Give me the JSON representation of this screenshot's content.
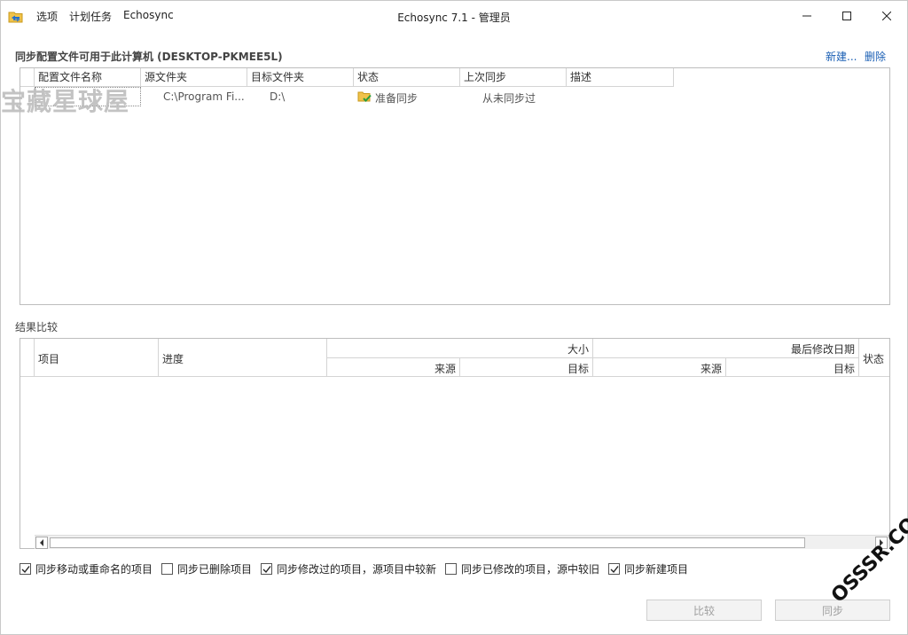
{
  "titlebar": {
    "app_icon": "folder-sync-icon",
    "menu": [
      "选项",
      "计划任务",
      "Echosync"
    ],
    "title": "Echosync 7.1 - 管理员",
    "controls": [
      "minimize-icon",
      "maximize-icon",
      "close-icon"
    ]
  },
  "profiles": {
    "heading": "同步配置文件可用于此计算机 (DESKTOP-PKMEE5L)",
    "new_link": "新建...",
    "delete_link": "删除",
    "columns": [
      "配置文件名称",
      "源文件夹",
      "目标文件夹",
      "状态",
      "上次同步",
      "描述"
    ],
    "rows": [
      {
        "name": "宝藏星球屋",
        "source": "C:\\Program Fi...",
        "target": "D:\\",
        "status_icon": "folder-check-icon",
        "status": "准备同步",
        "last_sync": "从未同步过",
        "description": ""
      }
    ]
  },
  "results": {
    "heading": "结果比较",
    "col_item": "项目",
    "col_progress": "进度",
    "col_size": "大小",
    "col_modified": "最后修改日期",
    "col_status": "状态",
    "sub_source": "来源",
    "sub_target": "目标"
  },
  "options": [
    {
      "label": "同步移动或重命名的项目",
      "checked": true
    },
    {
      "label": "同步已删除项目",
      "checked": false
    },
    {
      "label": "同步修改过的项目，源项目中较新",
      "checked": true
    },
    {
      "label": "同步已修改的项目，源中较旧",
      "checked": false
    },
    {
      "label": "同步新建项目",
      "checked": true
    }
  ],
  "buttons": {
    "compare": "比较",
    "sync": "同步"
  },
  "watermarks": {
    "overlay_text": "宝藏星球屋",
    "corner_text": "OSSSR.COM"
  },
  "colors": {
    "link": "#1a5fb4",
    "disabled_text": "#a0a0a0"
  }
}
